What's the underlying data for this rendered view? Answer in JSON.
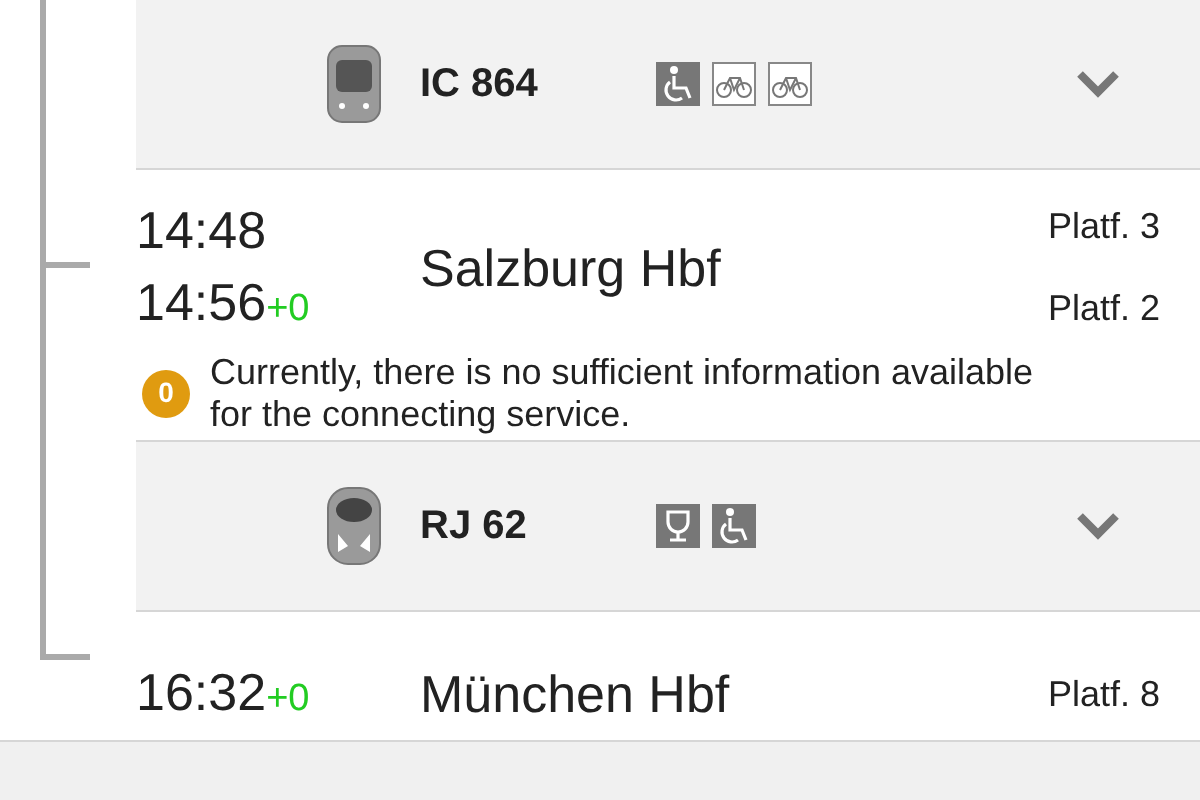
{
  "legs": [
    {
      "kind": "service",
      "vehicle": {
        "kind": "intercity"
      },
      "name": "IC 864",
      "amenities": [
        {
          "kind": "wheelchair"
        },
        {
          "kind": "bicycle"
        },
        {
          "kind": "bicycle"
        }
      ],
      "expanded": false
    },
    {
      "kind": "stop",
      "times": [
        {
          "time": "14:48"
        },
        {
          "time": "14:56",
          "delay": "+0"
        }
      ],
      "station": "Salzburg Hbf",
      "platforms": [
        "Platf. 3",
        "Platf. 2"
      ],
      "notice": {
        "badge": "0",
        "text": "Currently, there is no sufficient information available for the connecting service."
      }
    },
    {
      "kind": "service",
      "vehicle": {
        "kind": "railjet"
      },
      "name": "RJ 62",
      "amenities": [
        {
          "kind": "restaurant"
        },
        {
          "kind": "wheelchair"
        }
      ],
      "expanded": false
    },
    {
      "kind": "stop",
      "times": [
        {
          "time": "16:32",
          "delay": "+0"
        }
      ],
      "station": "München Hbf",
      "platforms": [
        "Platf. 8"
      ]
    }
  ]
}
